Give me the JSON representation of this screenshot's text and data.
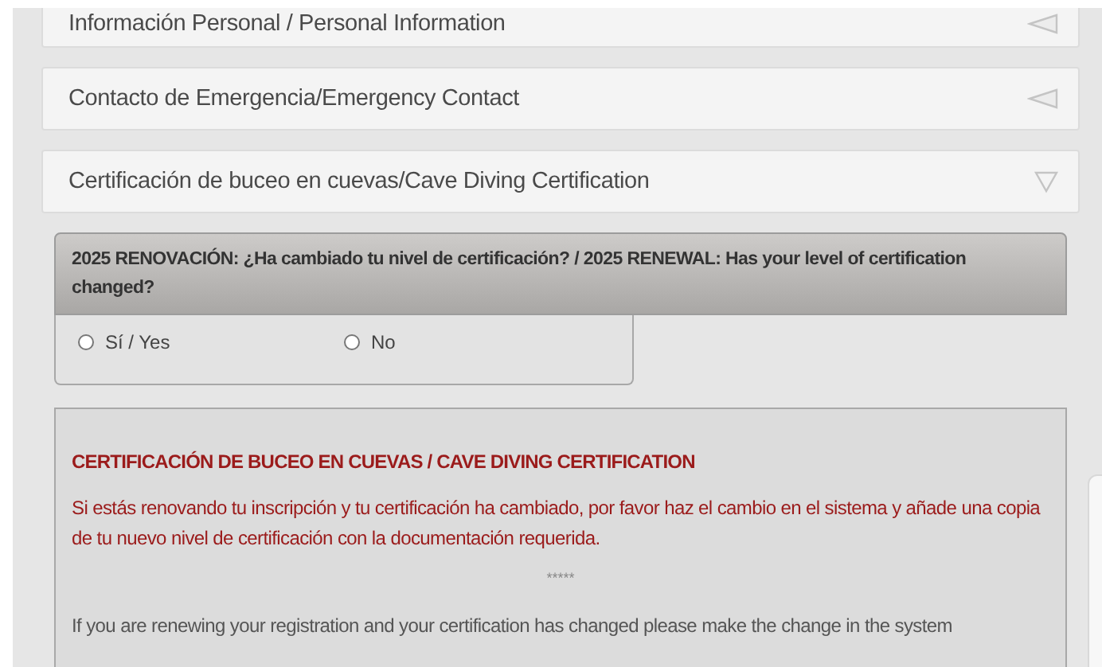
{
  "sections": [
    {
      "title": "Información Personal / Personal Information",
      "expanded": false
    },
    {
      "title": "Contacto de Emergencia/Emergency Contact",
      "expanded": false
    },
    {
      "title": "Certificación de buceo en cuevas/Cave Diving Certification",
      "expanded": true
    }
  ],
  "question": {
    "text": "2025 RENOVACIÓN: ¿Ha cambiado tu nivel de certificación? / 2025 RENEWAL: Has your level of certification changed?",
    "options": [
      {
        "label": "Sí / Yes",
        "selected": false
      },
      {
        "label": "No",
        "selected": false
      }
    ]
  },
  "notice": {
    "title": "CERTIFICACIÓN DE BUCEO EN CUEVAS / CAVE DIVING CERTIFICATION",
    "text_es": "Si estás renovando tu inscripción y tu certificación ha cambiado, por favor haz el cambio en el sistema y añade una copia de tu nuevo nivel de certificación con la documentación requerida.",
    "separator": "*****",
    "text_en": "If you are renewing your registration and your certification has changed please make the change in the system"
  }
}
